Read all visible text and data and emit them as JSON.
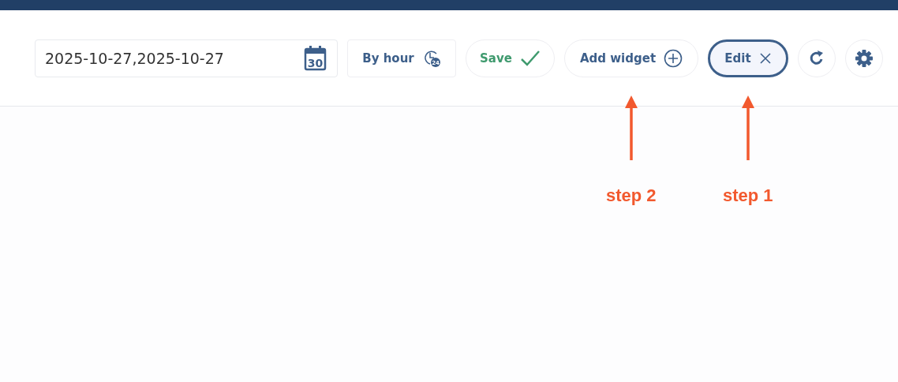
{
  "toolbar": {
    "date_range": {
      "value": "2025-10-27,2025-10-27",
      "calendar_day": "30"
    },
    "buttons": [
      {
        "kind": "grouping",
        "label": "By hour",
        "badge": "24",
        "selected": false
      },
      {
        "kind": "save",
        "label": "Save",
        "selected": false
      },
      {
        "kind": "add",
        "label": "Add widget",
        "selected": false,
        "annotation": "step 2"
      },
      {
        "kind": "edit",
        "label": "Edit",
        "selected": true,
        "annotation": "step 1"
      },
      {
        "kind": "refresh",
        "selected": false
      },
      {
        "kind": "settings",
        "selected": false
      }
    ]
  }
}
